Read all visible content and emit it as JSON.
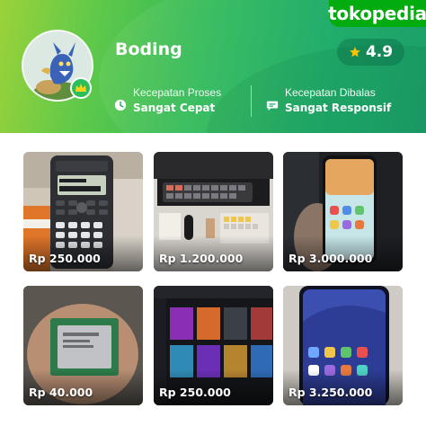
{
  "brand": {
    "logo_text": "tokopedia",
    "color": "#03ac0e"
  },
  "shop": {
    "name": "Boding",
    "rating": "4.9",
    "badge_icon": "crown-icon",
    "stats": [
      {
        "label": "Kecepatan Proses",
        "value": "Sangat Cepat",
        "icon": "clock-icon"
      },
      {
        "label": "Kecepatan Dibalas",
        "value": "Sangat Responsif",
        "icon": "chat-bubble-icon"
      }
    ]
  },
  "products": [
    {
      "price": "Rp 250.000"
    },
    {
      "price": "Rp 1.200.000"
    },
    {
      "price": "Rp 3.000.000"
    },
    {
      "price": "Rp 40.000"
    },
    {
      "price": "Rp 250.000"
    },
    {
      "price": "Rp 3.250.000"
    }
  ]
}
